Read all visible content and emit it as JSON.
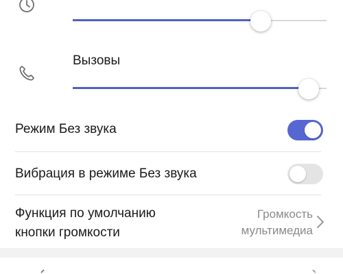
{
  "volume": {
    "alarm_slider": {
      "value_percent": 74
    },
    "calls_slider": {
      "label": "Вызовы",
      "value_percent": 93
    }
  },
  "settings": {
    "silent_mode": {
      "label": "Режим Без звука",
      "enabled": true
    },
    "vibrate_in_silent": {
      "label": "Вибрация в режиме Без звука",
      "enabled": false
    },
    "volume_key_function": {
      "label_line1": "Функция по умолчанию",
      "label_line2": "кнопки громкости",
      "value_line1": "Громкость",
      "value_line2": "мультимедиа"
    }
  },
  "icons": {
    "alarm": "clock-icon",
    "calls": "phone-icon",
    "more": "chevron-right-icon"
  },
  "colors": {
    "accent": "#5667d2",
    "toggle_off": "#e4e4e4",
    "secondary_text": "#8a8a8a"
  }
}
